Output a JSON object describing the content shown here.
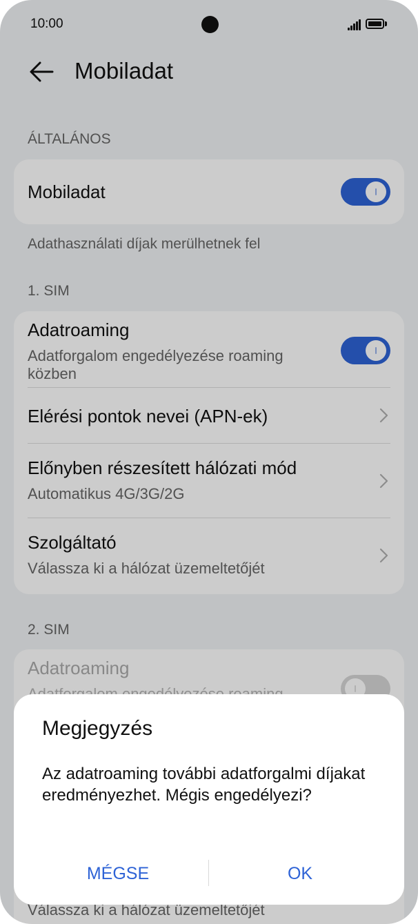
{
  "status_bar": {
    "time": "10:00",
    "signal_icon": "signal-icon",
    "battery_icon": "battery-icon"
  },
  "header": {
    "back_icon": "back-arrow-icon",
    "title": "Mobiladat"
  },
  "general": {
    "section_label": "ÁLTALÁNOS",
    "mobile_data": {
      "label": "Mobiladat",
      "enabled": true
    },
    "note": "Adathasználati díjak merülhetnek fel"
  },
  "sim1": {
    "section_label": "1. SIM",
    "data_roaming": {
      "title": "Adatroaming",
      "subtitle": "Adatforgalom engedélyezése roaming közben",
      "enabled": true
    },
    "apn": {
      "title": "Elérési pontok nevei (APN-ek)"
    },
    "network_mode": {
      "title": "Előnyben részesített hálózati mód",
      "subtitle": "Automatikus 4G/3G/2G"
    },
    "carrier": {
      "title": "Szolgáltató",
      "subtitle": "Válassza ki a hálózat üzemeltetőjét"
    }
  },
  "sim2": {
    "section_label": "2. SIM",
    "data_roaming": {
      "title": "Adatroaming",
      "subtitle": "Adatforgalom engedélyezése roaming közben",
      "enabled": false
    },
    "carrier": {
      "subtitle": "Válassza ki a hálózat üzemeltetőjét"
    }
  },
  "dialog": {
    "title": "Megjegyzés",
    "message": "Az adatroaming további adatforgalmi díjakat eredményezhet. Mégis engedélyezi?",
    "cancel_label": "MÉGSE",
    "ok_label": "OK"
  },
  "colors": {
    "accent": "#2e63d6",
    "background": "#f1f3f5",
    "card": "#ffffff"
  }
}
